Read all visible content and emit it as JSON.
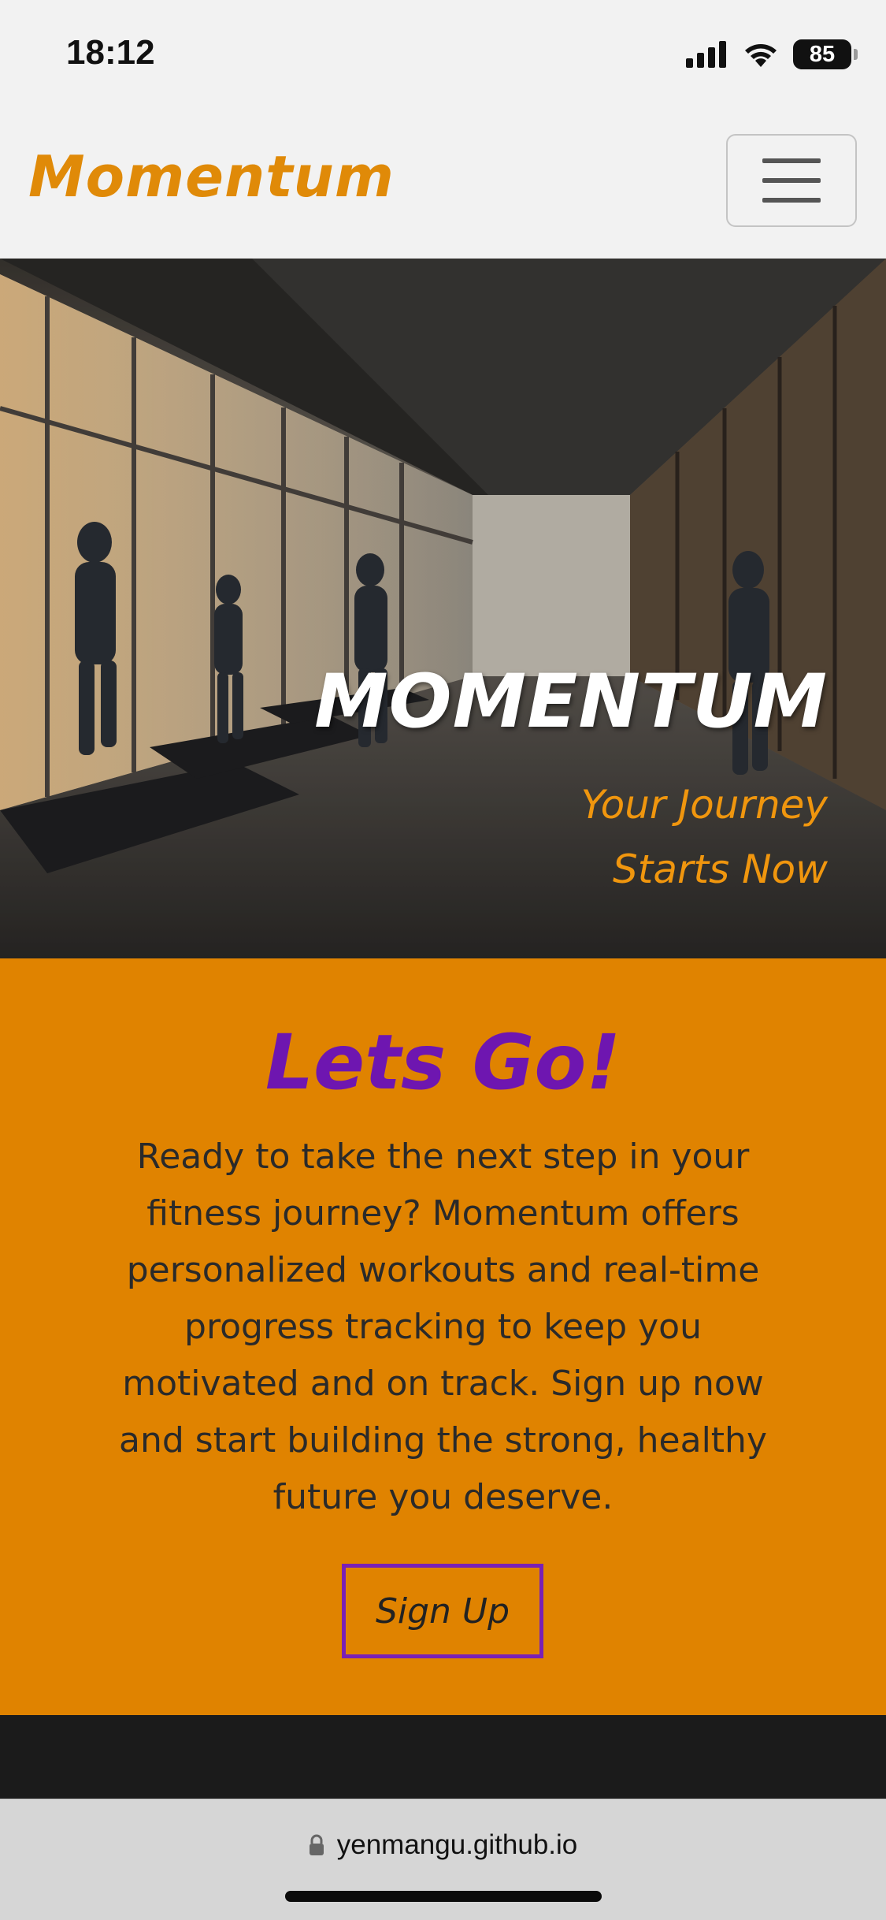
{
  "status_bar": {
    "time": "18:12",
    "battery": "85"
  },
  "navbar": {
    "brand": "Momentum",
    "menu_icon": "hamburger-menu-icon"
  },
  "hero": {
    "title": "MOMENTUM",
    "subtitle": "Your Journey Starts Now"
  },
  "cta": {
    "title": "Lets Go!",
    "text": "Ready to take the next step in your fitness journey? Momentum offers personalized workouts and real-time progress tracking to keep you motivated and on track. Sign up now and start building the strong, healthy future you deserve.",
    "button": "Sign Up"
  },
  "browser": {
    "url": "yenmangu.github.io"
  },
  "colors": {
    "brand": "#e08a08",
    "cta_background": "#e08300",
    "cta_title": "#6e16b0",
    "button_border": "#7a20b5",
    "footer": "#1b1b1b"
  }
}
